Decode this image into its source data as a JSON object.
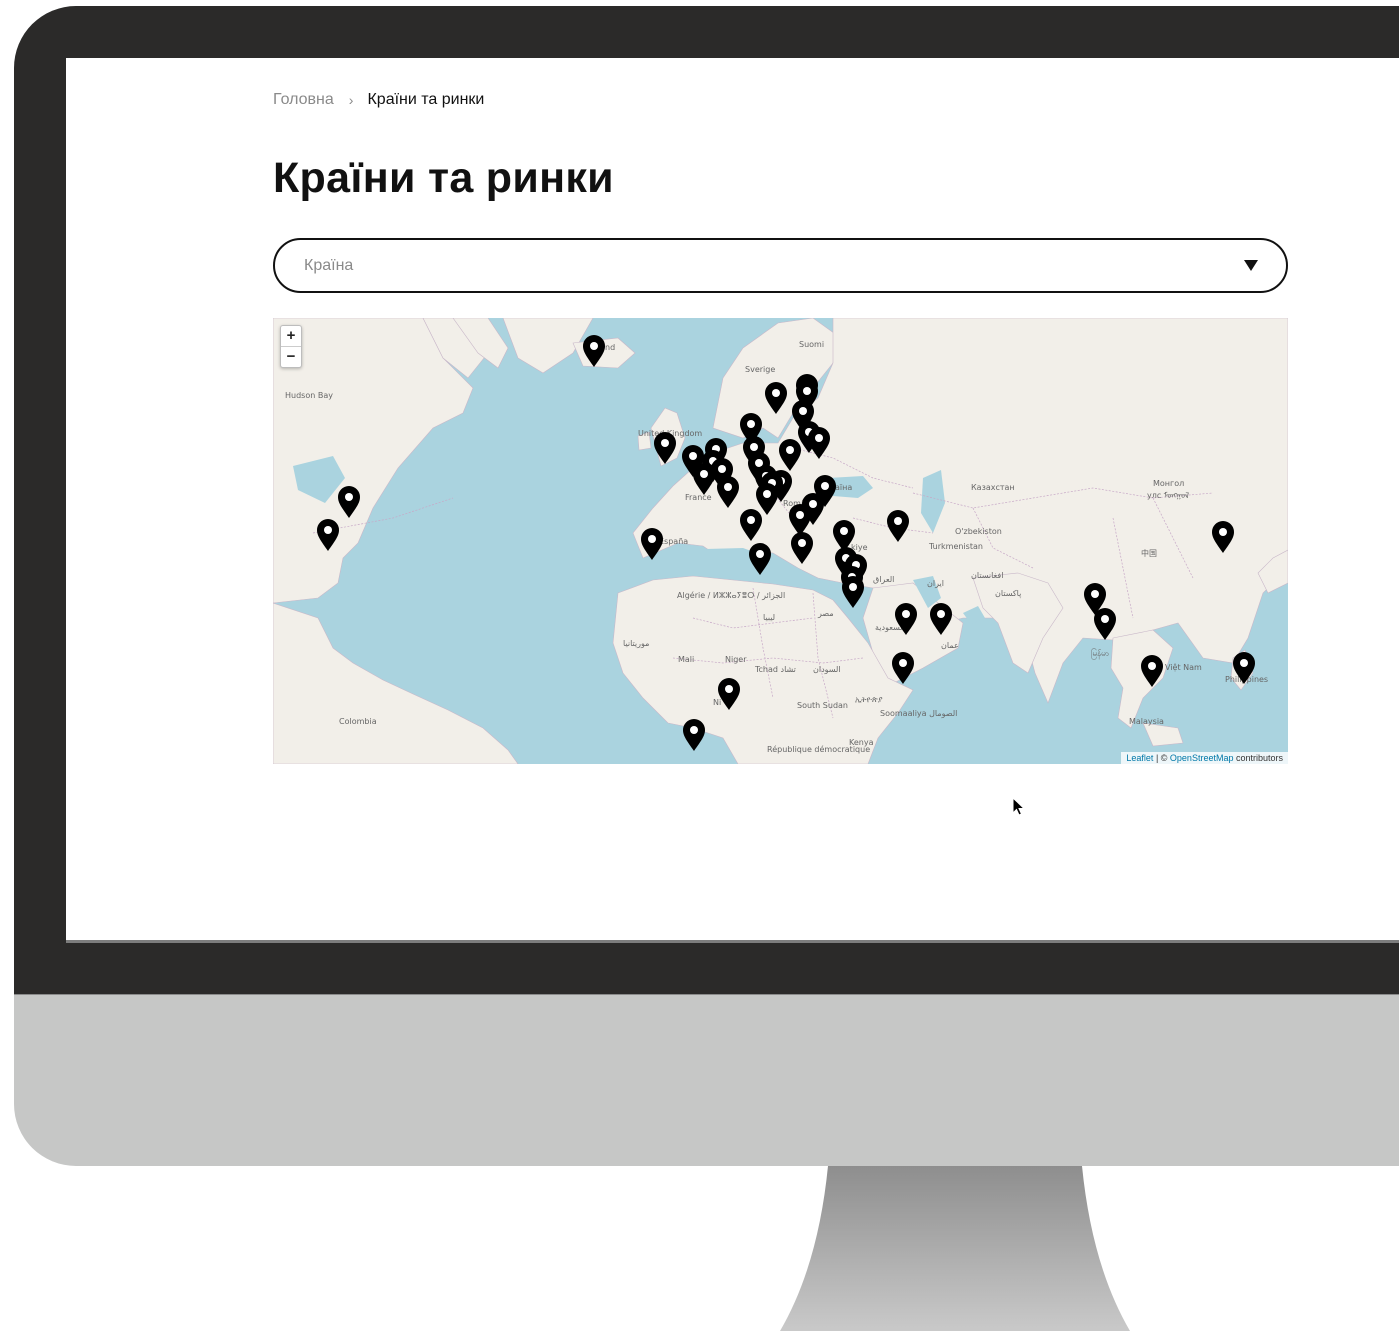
{
  "breadcrumb": {
    "home": "Головна",
    "separator": "›",
    "current": "Країни та ринки"
  },
  "page": {
    "title": "Країни та ринки"
  },
  "country_select": {
    "placeholder": "Країна",
    "caret_icon": "triangle-down-icon"
  },
  "map": {
    "zoom_in_label": "+",
    "zoom_out_label": "−",
    "attribution": {
      "leaflet": "Leaflet",
      "separator": " | © ",
      "osm": "OpenStreetMap",
      "suffix": " contributors"
    },
    "labels": {
      "suomi": "Suomi",
      "sverige": "Sverige",
      "united_kingdom": "United Kingdom",
      "france": "France",
      "espana": "España",
      "romania": "Româ",
      "ukraina": "аїна",
      "kazakhstan": "Казахстан",
      "mongol": "Монгол",
      "mongol_script": "улс ᠮᠣᠩᠭᠣᠯ",
      "china": "中国",
      "uzbekiston": "O'zbekiston",
      "turkmenistan": "Turkmenistan",
      "turkiye": "kiye",
      "iraq": "العراق",
      "iran": "ایران",
      "afghanistan": "افغانستان",
      "pakistan": "پاکستان",
      "algeria": "Algérie / ⵍⵣⵣⴰⵢⴻⵔ / الجزائر",
      "libya": "ليبيا",
      "egypt": "مصر",
      "saudi": "السعودية",
      "oman": "عمان",
      "mauritania": "موريتانيا",
      "mali": "Mali",
      "niger": "Niger",
      "chad": "Tchad تشاد",
      "sudan": "السودان",
      "south_sudan": "South Sudan",
      "ethiopia": "ኢትዮጵያ",
      "somalia": "Soomaaliya الصومال",
      "kenya": "Kenya",
      "drc": "République démocratique",
      "colombia": "Colombia",
      "myanmar": "မြန်မာ",
      "vietnam": "Việt Nam",
      "philippines": "Philippines",
      "malaysia": "Malaysia",
      "hudson_bay": "Hudson Bay",
      "iceland": "nd",
      "nigeria": "Ni"
    },
    "marker_icon": "map-pin-icon"
  },
  "cursor_icon": "mouse-pointer-icon",
  "colors": {
    "water": "#aad3df",
    "land": "#f2efe9",
    "marker": "#000000",
    "bezel": "#2b2a29",
    "chin": "#c6c7c6",
    "accent_link": "#0078a8"
  }
}
